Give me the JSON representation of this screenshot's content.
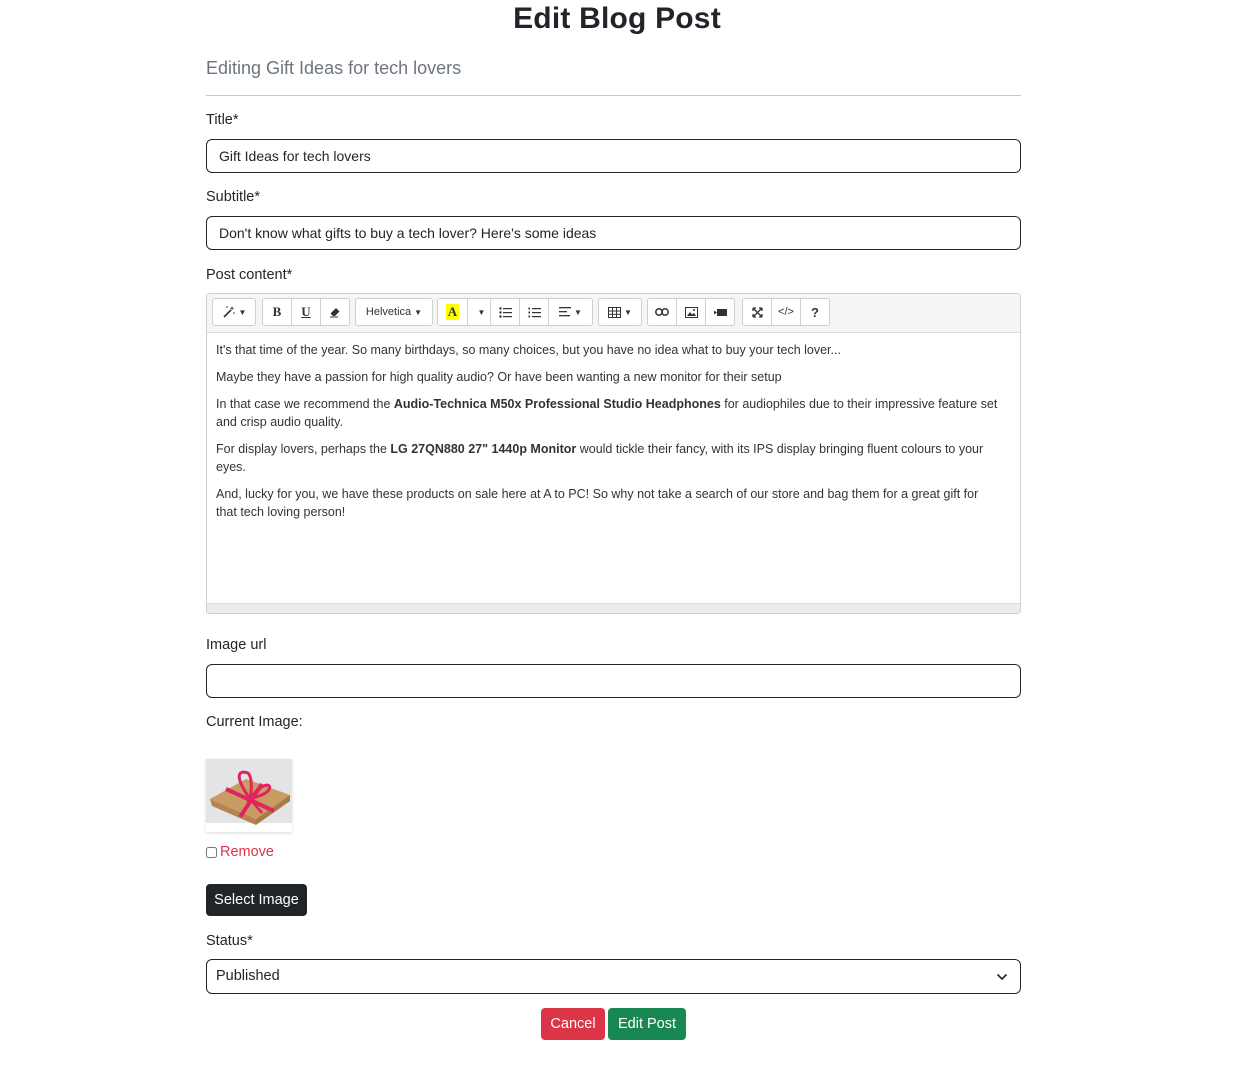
{
  "page": {
    "title": "Edit Blog Post",
    "subheading": "Editing Gift Ideas for tech lovers"
  },
  "form": {
    "title_label": "Title*",
    "title_value": "Gift Ideas for tech lovers",
    "subtitle_label": "Subtitle*",
    "subtitle_value": "Don't know what gifts to buy a tech lover? Here's some ideas",
    "content_label": "Post content*",
    "image_url_label": "Image url",
    "image_url_value": "",
    "current_image_label": "Current Image:",
    "remove_label": "Remove",
    "select_image_label": "Select Image",
    "status_label": "Status*",
    "status_value": "Published",
    "cancel_label": "Cancel",
    "submit_label": "Edit Post"
  },
  "editor": {
    "font_name": "Helvetica",
    "toolbar_icons": [
      "magic-icon",
      "bold-icon",
      "underline-icon",
      "eraser-icon",
      "font-name-dropdown",
      "font-color-icon",
      "unordered-list-icon",
      "ordered-list-icon",
      "align-icon",
      "table-icon",
      "link-icon",
      "picture-icon",
      "video-icon",
      "fullscreen-icon",
      "code-view-icon",
      "help-icon"
    ],
    "paragraphs": [
      {
        "segments": [
          {
            "text": "It's that time of the year. So many birthdays, so many choices, but you have no idea what to buy your tech lover..."
          }
        ]
      },
      {
        "segments": [
          {
            "text": "Maybe they have a passion for high quality audio? Or have been wanting a new monitor for their setup"
          }
        ]
      },
      {
        "segments": [
          {
            "text": "In that case we recommend the "
          },
          {
            "text": "Audio-Technica M50x Professional Studio Headphones",
            "bold": true
          },
          {
            "text": " for audiophiles due to their impressive feature set and crisp audio quality."
          }
        ]
      },
      {
        "segments": [
          {
            "text": "For display lovers, perhaps the "
          },
          {
            "text": "LG 27QN880 27\" 1440p Monitor",
            "bold": true
          },
          {
            "text": " would tickle their fancy, with its IPS display bringing fluent colours to your eyes."
          }
        ]
      },
      {
        "segments": [
          {
            "text": "And, lucky for you, we have these products on sale here at A to PC! So why not take a search of our store and bag them for a great gift for that tech loving person!"
          }
        ]
      }
    ]
  },
  "colors": {
    "danger": "#dc3545",
    "success": "#198754",
    "dark": "#212529",
    "muted": "#6c757d",
    "highlight": "#ffff00"
  }
}
